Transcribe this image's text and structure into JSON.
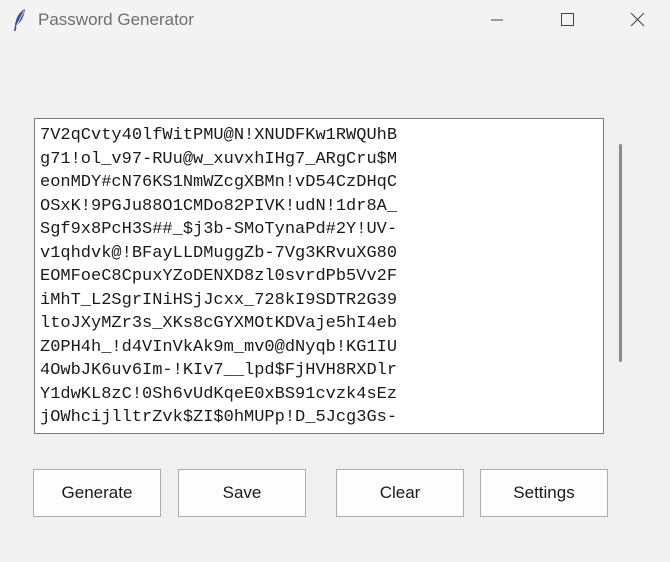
{
  "window": {
    "title": "Password Generator"
  },
  "textbox": {
    "lines": [
      "7V2qCvty40lfWitPMU@N!XNUDFKw1RWQUhB",
      "g71!ol_v97-RUu@w_xuvxhIHg7_ARgCru$M",
      "eonMDY#cN76KS1NmWZcgXBMn!vD54CzDHqC",
      "OSxK!9PGJu88O1CMDo82PIVK!udN!1dr8A_",
      "Sgf9x8PcH3S##_$j3b-SMoTynaPd#2Y!UV-",
      "v1qhdvk@!BFayLLDMuggZb-7Vg3KRvuXG80",
      "EOMFoeC8CpuxYZoDENXD8zl0svrdPb5Vv2F",
      "iMhT_L2SgrINiHSjJcxx_728kI9SDTR2G39",
      "ltoJXyMZr3s_XKs8cGYXMOtKDVaje5hI4eb",
      "Z0PH4h_!d4VInVkAk9m_mv0@dNyqb!KG1IU",
      "4OwbJK6uv6Im-!KIv7__lpd$FjHVH8RXDlr",
      "Y1dwKL8zC!0Sh6vUdKqeE0xBS91cvzk4sEz",
      "jOWhcijlltrZvk$ZI$0hMUPp!D_5Jcg3Gs-"
    ]
  },
  "buttons": {
    "generate": "Generate",
    "save": "Save",
    "clear": "Clear",
    "settings": "Settings"
  }
}
